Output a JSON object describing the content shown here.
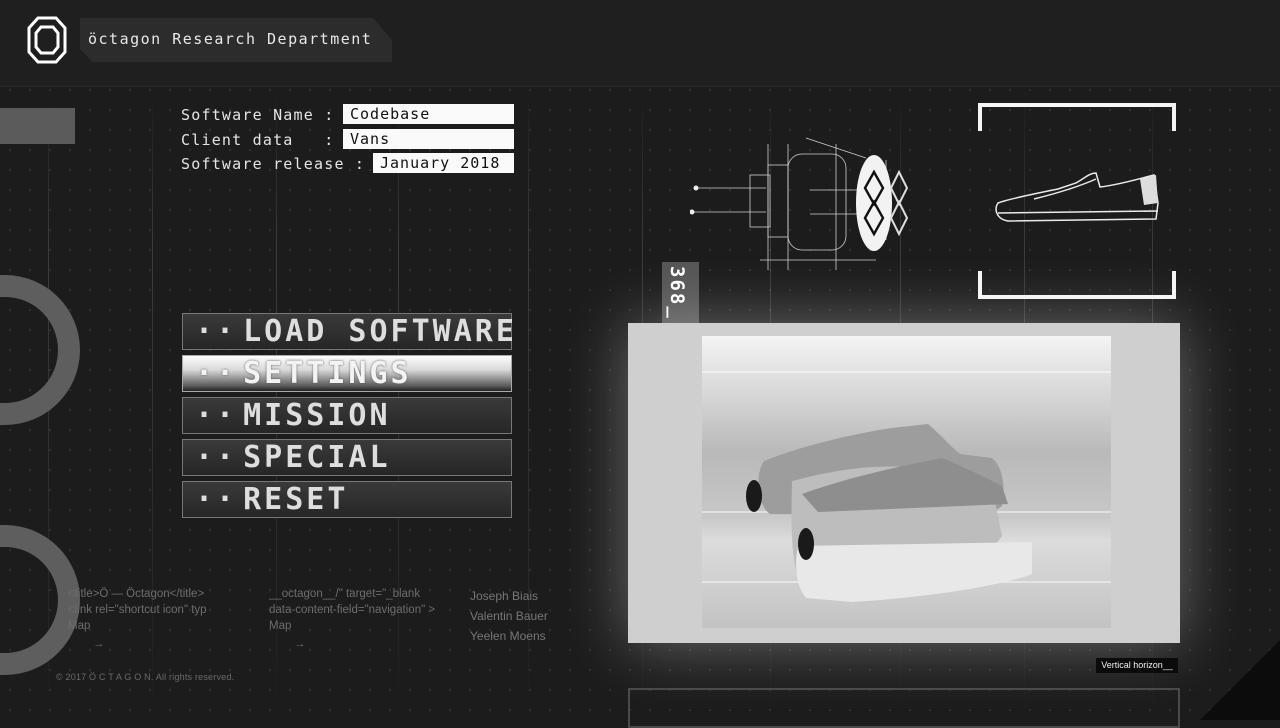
{
  "header": {
    "title": "öctagon Research Department",
    "logo_icon": "octagon-logo-icon"
  },
  "info": {
    "software_name_label": "Software Name :",
    "software_name_value": "Codebase",
    "client_data_label": "Client data   :",
    "client_data_value": "Vans",
    "software_release_label": "Software release :",
    "software_release_value": "January 2018"
  },
  "menu": {
    "dots": "··",
    "items": [
      {
        "label": "LOAD SOFTWARE"
      },
      {
        "label": "SETTINGS"
      },
      {
        "label": "MISSION"
      },
      {
        "label": "SPECIAL"
      },
      {
        "label": "RESET"
      }
    ],
    "active_index": 1
  },
  "code_tag": "368_",
  "footer": {
    "col1": [
      "<title>Ö — Öctagon</title>",
      "<link rel=\"shortcut icon\" typ",
      "Map"
    ],
    "col2": [
      "__octagon__/\" target=\"_blank",
      "data-content-field=\"navigation\" >",
      "Map"
    ],
    "arrow": "→",
    "credits": [
      "Joseph Biais",
      "Valentin Bauer",
      "Yeelen Moens"
    ],
    "copyright": "© 2017 Ö C T A G O N. All rights reserved."
  },
  "video_label": "Vertical horizon__",
  "colors": {
    "background": "#1c1c1c",
    "accent": "#ffffff",
    "menu_border": "#777777"
  }
}
